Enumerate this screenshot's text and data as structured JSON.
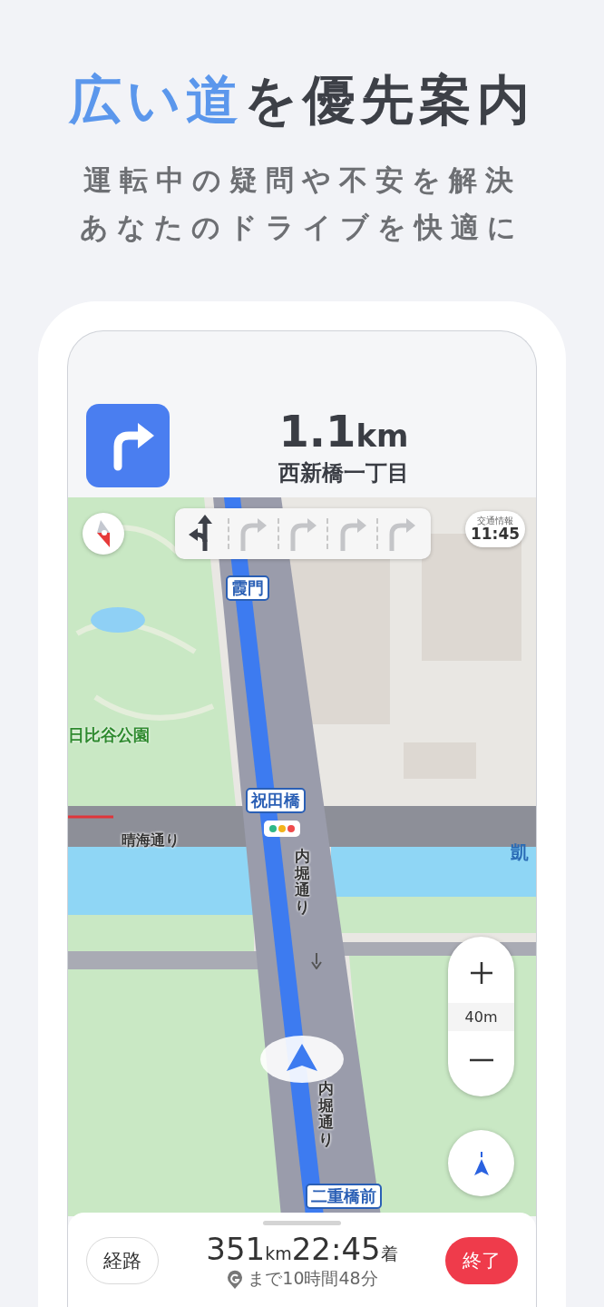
{
  "headline": {
    "highlight": "広い道",
    "rest": "を優先案内"
  },
  "subtitle": [
    "運転中の疑問や不安を解決",
    "あなたのドライブを快適に"
  ],
  "guidance": {
    "distance": "1.1",
    "unit": "km",
    "place": "西新橋一丁目"
  },
  "lanes": [
    {
      "kind": "straight-left",
      "recommended": true
    },
    {
      "kind": "right",
      "recommended": false
    },
    {
      "kind": "right",
      "recommended": false
    },
    {
      "kind": "right",
      "recommended": false
    },
    {
      "kind": "right",
      "recommended": false
    }
  ],
  "traffic_info": {
    "label": "交通情報",
    "time": "11:45"
  },
  "map_labels": [
    {
      "kind": "boxed",
      "text": "霞門"
    },
    {
      "kind": "park",
      "text": "日比谷公園"
    },
    {
      "kind": "boxed",
      "text": "祝田橋"
    },
    {
      "kind": "road",
      "text": "晴海通り"
    },
    {
      "kind": "road-vertical",
      "text": "内堀通り"
    },
    {
      "kind": "area",
      "text": "凱"
    },
    {
      "kind": "road-vertical",
      "text": "内堀通り"
    },
    {
      "kind": "boxed",
      "text": "二重橋前"
    }
  ],
  "zoom": {
    "scale": "40m"
  },
  "trip": {
    "route_button": "経路",
    "distance": "351",
    "distance_unit": "km",
    "arrival": "22:45",
    "arrival_suffix": "着",
    "remaining": "まで10時間48分",
    "end_button": "終了"
  }
}
